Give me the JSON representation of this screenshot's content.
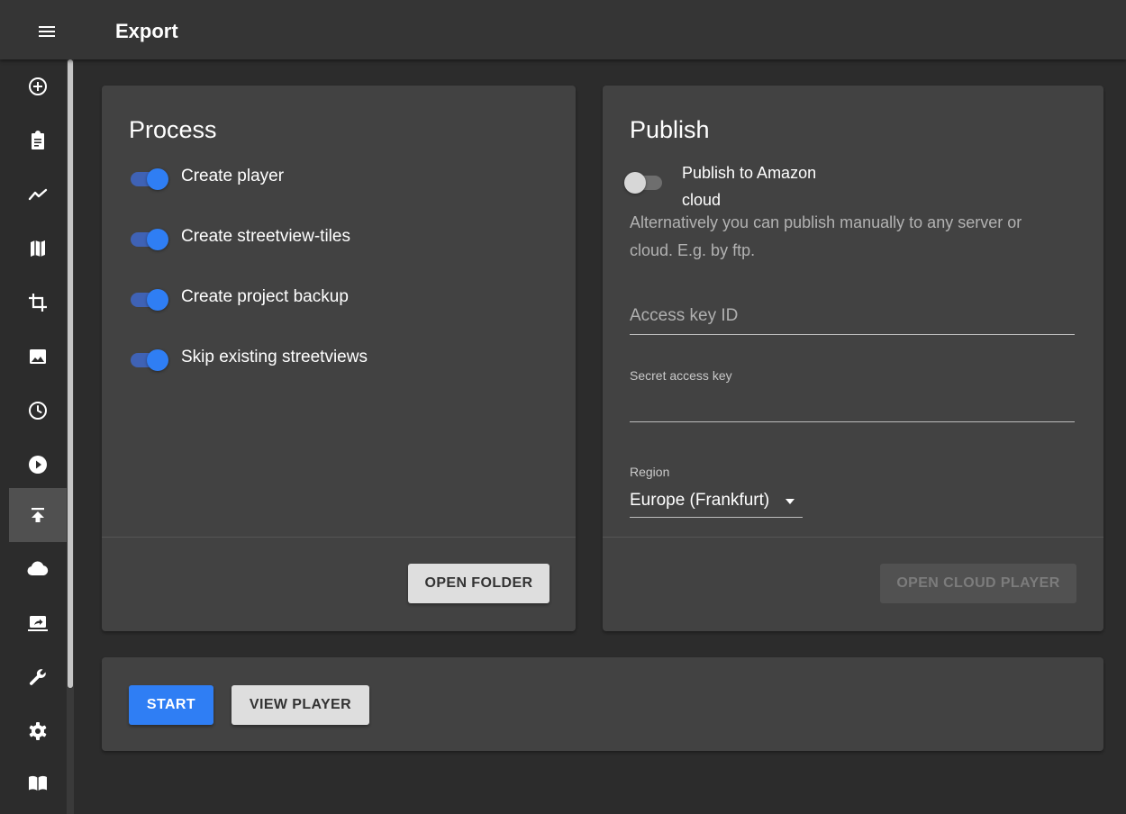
{
  "header": {
    "title": "Export",
    "menu_icon": "menu-icon"
  },
  "sidebar": {
    "active_index": 8,
    "items": [
      {
        "name": "add-circle-icon"
      },
      {
        "name": "clipboard-icon"
      },
      {
        "name": "trending-line-icon"
      },
      {
        "name": "map-icon"
      },
      {
        "name": "crop-icon"
      },
      {
        "name": "image-icon"
      },
      {
        "name": "clock-icon"
      },
      {
        "name": "play-circle-icon"
      },
      {
        "name": "publish-icon"
      },
      {
        "name": "cloud-icon"
      },
      {
        "name": "screen-share-icon"
      },
      {
        "name": "wrench-icon"
      },
      {
        "name": "settings-icon"
      },
      {
        "name": "book-icon"
      }
    ]
  },
  "process": {
    "title": "Process",
    "toggles": [
      {
        "label": "Create player",
        "on": true
      },
      {
        "label": "Create streetview-tiles",
        "on": true
      },
      {
        "label": "Create project backup",
        "on": true
      },
      {
        "label": "Skip existing streetviews",
        "on": true
      }
    ],
    "open_folder_label": "OPEN FOLDER"
  },
  "publish": {
    "title": "Publish",
    "toggle_label_line1": "Publish to Amazon",
    "toggle_label_line2": "cloud",
    "toggle_on": false,
    "helper_line1": "Alternatively you can publish manually to any server or",
    "helper_line2": "cloud. E.g. by ftp.",
    "access_key_label": "Access key ID",
    "secret_key_label": "Secret access key",
    "region_label": "Region",
    "region_value": "Europe (Frankfurt)",
    "open_cloud_player_label": "OPEN CLOUD PLAYER"
  },
  "actions": {
    "start_label": "START",
    "view_player_label": "VIEW PLAYER"
  },
  "colors": {
    "accent": "#2f7ef4",
    "card": "#424242",
    "background": "#2c2c2c",
    "topbar": "#353535"
  }
}
